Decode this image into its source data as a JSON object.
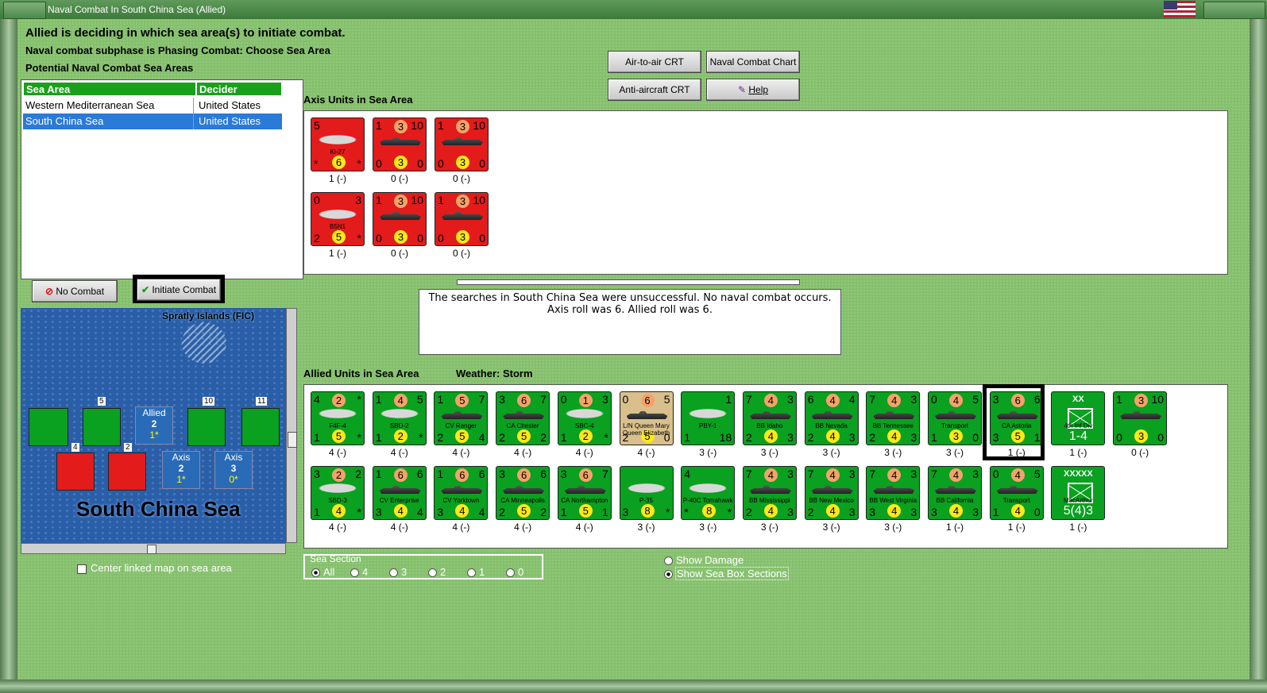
{
  "window": {
    "title": "Naval Combat In South China Sea (Allied)"
  },
  "status": {
    "line1": "Allied is deciding in which sea area(s) to initiate combat.",
    "line2": "Naval combat subphase is Phasing Combat: Choose Sea Area",
    "line3": "Potential Naval Combat Sea Areas"
  },
  "table": {
    "headers": [
      "Sea Area",
      "Decider"
    ],
    "rows": [
      {
        "area": "Western Mediterranean Sea",
        "decider": "United States"
      },
      {
        "area": "South China Sea",
        "decider": "United States"
      }
    ]
  },
  "buttons": {
    "air_to_air": "Air-to-air CRT",
    "naval_chart": "Naval Combat Chart",
    "anti_aircraft": "Anti-aircraft CRT",
    "help": "Help",
    "no_combat": "No Combat",
    "initiate_combat": "Initiate Combat"
  },
  "axis_section": {
    "title": "Axis Units in Sea Area"
  },
  "allied_section": {
    "title": "Allied Units in Sea Area",
    "weather": "Weather:  Storm"
  },
  "message": {
    "line1": "The searches in South China Sea were unsuccessful.  No naval combat occurs.",
    "line2": "Axis roll was 6.  Allied roll was 6."
  },
  "map": {
    "island": "Spratly Islands (FIC)",
    "sea_name": "South China Sea",
    "allied_box": {
      "label": "Allied",
      "n": "2",
      "sub": "1*"
    },
    "axis_box1": {
      "label": "Axis",
      "n": "2",
      "sub": "1*"
    },
    "axis_box2": {
      "label": "Axis",
      "n": "3",
      "sub": "0*"
    },
    "stack_counts": [
      "5",
      "10",
      "11",
      "4",
      "2"
    ]
  },
  "center_linked": "Center linked map on sea area",
  "sea_section": {
    "title": "Sea Section",
    "options": [
      "All",
      "4",
      "3",
      "2",
      "1",
      "0"
    ]
  },
  "show_damage": "Show Damage",
  "show_sea_box": "Show Sea Box Sections",
  "axis_units": [
    {
      "name": "Ki-27",
      "kind": "plane",
      "color": "red",
      "tl": "5",
      "tr": "",
      "bl": "*",
      "br": "*",
      "top": "",
      "bot": "6",
      "label": "1 (-)"
    },
    {
      "name": "",
      "kind": "ship",
      "color": "red",
      "tl": "1",
      "tr": "10",
      "bl": "0",
      "br": "0",
      "top": "3",
      "bot": "3",
      "label": "0 (-)"
    },
    {
      "name": "",
      "kind": "ship",
      "color": "red",
      "tl": "1",
      "tr": "10",
      "bl": "0",
      "br": "0",
      "top": "3",
      "bot": "3",
      "label": "0 (-)"
    },
    {
      "name": "B5N1",
      "kind": "plane",
      "color": "red",
      "tl": "0",
      "tr": "3",
      "bl": "2",
      "br": "*",
      "top": "",
      "bot": "5",
      "label": "1 (-)"
    },
    {
      "name": "",
      "kind": "ship",
      "color": "red",
      "tl": "1",
      "tr": "10",
      "bl": "0",
      "br": "0",
      "top": "3",
      "bot": "3",
      "label": "0 (-)"
    },
    {
      "name": "",
      "kind": "ship",
      "color": "red",
      "tl": "1",
      "tr": "10",
      "bl": "0",
      "br": "0",
      "top": "3",
      "bot": "3",
      "label": "0 (-)"
    }
  ],
  "allied_units": [
    {
      "name": "F4F-4",
      "kind": "plane",
      "color": "green",
      "tl": "4",
      "tr": "*",
      "bl": "1",
      "br": "*",
      "top": "2",
      "bot": "5",
      "label": "4 (-)"
    },
    {
      "name": "SBD-2",
      "kind": "plane",
      "color": "green",
      "tl": "1",
      "tr": "5",
      "bl": "1",
      "br": "*",
      "top": "4",
      "bot": "2",
      "label": "4 (-)"
    },
    {
      "name": "CV Ranger",
      "kind": "ship",
      "color": "green",
      "tl": "1",
      "tr": "7",
      "bl": "2",
      "br": "4",
      "top": "5",
      "bot": "5",
      "label": "4 (-)"
    },
    {
      "name": "CA Chester",
      "kind": "ship",
      "color": "green",
      "tl": "3",
      "tr": "7",
      "bl": "2",
      "br": "2",
      "top": "6",
      "bot": "5",
      "label": "4 (-)"
    },
    {
      "name": "SBC-4",
      "kind": "plane",
      "color": "green",
      "tl": "0",
      "tr": "3",
      "bl": "1",
      "br": "*",
      "top": "1",
      "bot": "2",
      "label": "4 (-)"
    },
    {
      "name": "L/N Queen Mary Queen Elizabeth",
      "kind": "ship",
      "color": "tan",
      "tl": "0",
      "tr": "5",
      "bl": "2",
      "br": "0",
      "top": "6",
      "bot": "5",
      "label": "4 (-)"
    },
    {
      "name": "PBY-1",
      "kind": "plane",
      "color": "green",
      "tl": "",
      "tr": "1",
      "bl": "1",
      "br": "18",
      "top": "",
      "bot": "",
      "label": "3 (-)"
    },
    {
      "name": "BB Idaho",
      "kind": "ship",
      "color": "green",
      "tl": "7",
      "tr": "3",
      "bl": "2",
      "br": "3",
      "top": "4",
      "bot": "4",
      "label": "3 (-)"
    },
    {
      "name": "BB Nevada",
      "kind": "ship",
      "color": "green",
      "tl": "6",
      "tr": "4",
      "bl": "2",
      "br": "3",
      "top": "4",
      "bot": "4",
      "label": "3 (-)"
    },
    {
      "name": "BB Tennessee",
      "kind": "ship",
      "color": "green",
      "tl": "7",
      "tr": "3",
      "bl": "2",
      "br": "3",
      "top": "4",
      "bot": "4",
      "label": "3 (-)"
    },
    {
      "name": "Transport",
      "kind": "ship",
      "color": "green",
      "tl": "0",
      "tr": "5",
      "bl": "1",
      "br": "0",
      "top": "4",
      "bot": "3",
      "label": "3 (-)"
    },
    {
      "name": "CA Astoria",
      "kind": "ship",
      "color": "green",
      "tl": "3",
      "tr": "6",
      "bl": "3",
      "br": "1",
      "top": "6",
      "bot": "5",
      "label": "1 (-)"
    },
    {
      "name": "4th Inf Div",
      "kind": "army",
      "color": "green",
      "tl": "",
      "tr": "",
      "bl": "",
      "br": "",
      "top": "XX",
      "bot": "1-4",
      "label": "1 (-)"
    },
    {
      "name": "",
      "kind": "ship",
      "color": "green",
      "tl": "1",
      "tr": "10",
      "bl": "0",
      "br": "0",
      "top": "3",
      "bot": "3",
      "label": "0 (-)"
    },
    {
      "name": "SBD-3",
      "kind": "plane",
      "color": "green",
      "tl": "3",
      "tr": "2",
      "bl": "1",
      "br": "*",
      "top": "2",
      "bot": "4",
      "label": "4 (-)"
    },
    {
      "name": "CV Enterprise",
      "kind": "ship",
      "color": "green",
      "tl": "1",
      "tr": "6",
      "bl": "3",
      "br": "4",
      "top": "6",
      "bot": "4",
      "label": "4 (-)"
    },
    {
      "name": "CV Yorktown",
      "kind": "ship",
      "color": "green",
      "tl": "1",
      "tr": "6",
      "bl": "3",
      "br": "4",
      "top": "6",
      "bot": "4",
      "label": "4 (-)"
    },
    {
      "name": "CA Minneapolis",
      "kind": "ship",
      "color": "green",
      "tl": "3",
      "tr": "6",
      "bl": "2",
      "br": "2",
      "top": "6",
      "bot": "5",
      "label": "4 (-)"
    },
    {
      "name": "CA Northampton",
      "kind": "ship",
      "color": "green",
      "tl": "3",
      "tr": "7",
      "bl": "1",
      "br": "1",
      "top": "6",
      "bot": "5",
      "label": "4 (-)"
    },
    {
      "name": "P-35",
      "kind": "plane",
      "color": "green",
      "tl": "",
      "tr": "",
      "bl": "3",
      "br": "*",
      "top": "",
      "bot": "8",
      "label": "3 (-)"
    },
    {
      "name": "P-40C Tomahawk",
      "kind": "plane",
      "color": "green",
      "tl": "4",
      "tr": "",
      "bl": "*",
      "br": "*",
      "top": "",
      "bot": "8",
      "label": "3 (-)"
    },
    {
      "name": "BB Mississippi",
      "kind": "ship",
      "color": "green",
      "tl": "7",
      "tr": "3",
      "bl": "2",
      "br": "3",
      "top": "4",
      "bot": "4",
      "label": "3 (-)"
    },
    {
      "name": "BB New Mexico",
      "kind": "ship",
      "color": "green",
      "tl": "7",
      "tr": "3",
      "bl": "2",
      "br": "3",
      "top": "4",
      "bot": "4",
      "label": "3 (-)"
    },
    {
      "name": "BB West Virginia",
      "kind": "ship",
      "color": "green",
      "tl": "7",
      "tr": "3",
      "bl": "3",
      "br": "3",
      "top": "4",
      "bot": "4",
      "label": "3 (-)"
    },
    {
      "name": "BB California",
      "kind": "ship",
      "color": "green",
      "tl": "7",
      "tr": "3",
      "bl": "3",
      "br": "3",
      "top": "4",
      "bot": "4",
      "label": "1 (-)"
    },
    {
      "name": "Transport",
      "kind": "ship",
      "color": "green",
      "tl": "0",
      "tr": "5",
      "bl": "1",
      "br": "0",
      "top": "4",
      "bot": "4",
      "label": "1 (-)"
    },
    {
      "name": "MacArthur",
      "kind": "army",
      "color": "green",
      "tl": "",
      "tr": "",
      "bl": "",
      "br": "",
      "top": "XXXXX",
      "bot": "5(4)3",
      "label": "1 (-)"
    }
  ]
}
